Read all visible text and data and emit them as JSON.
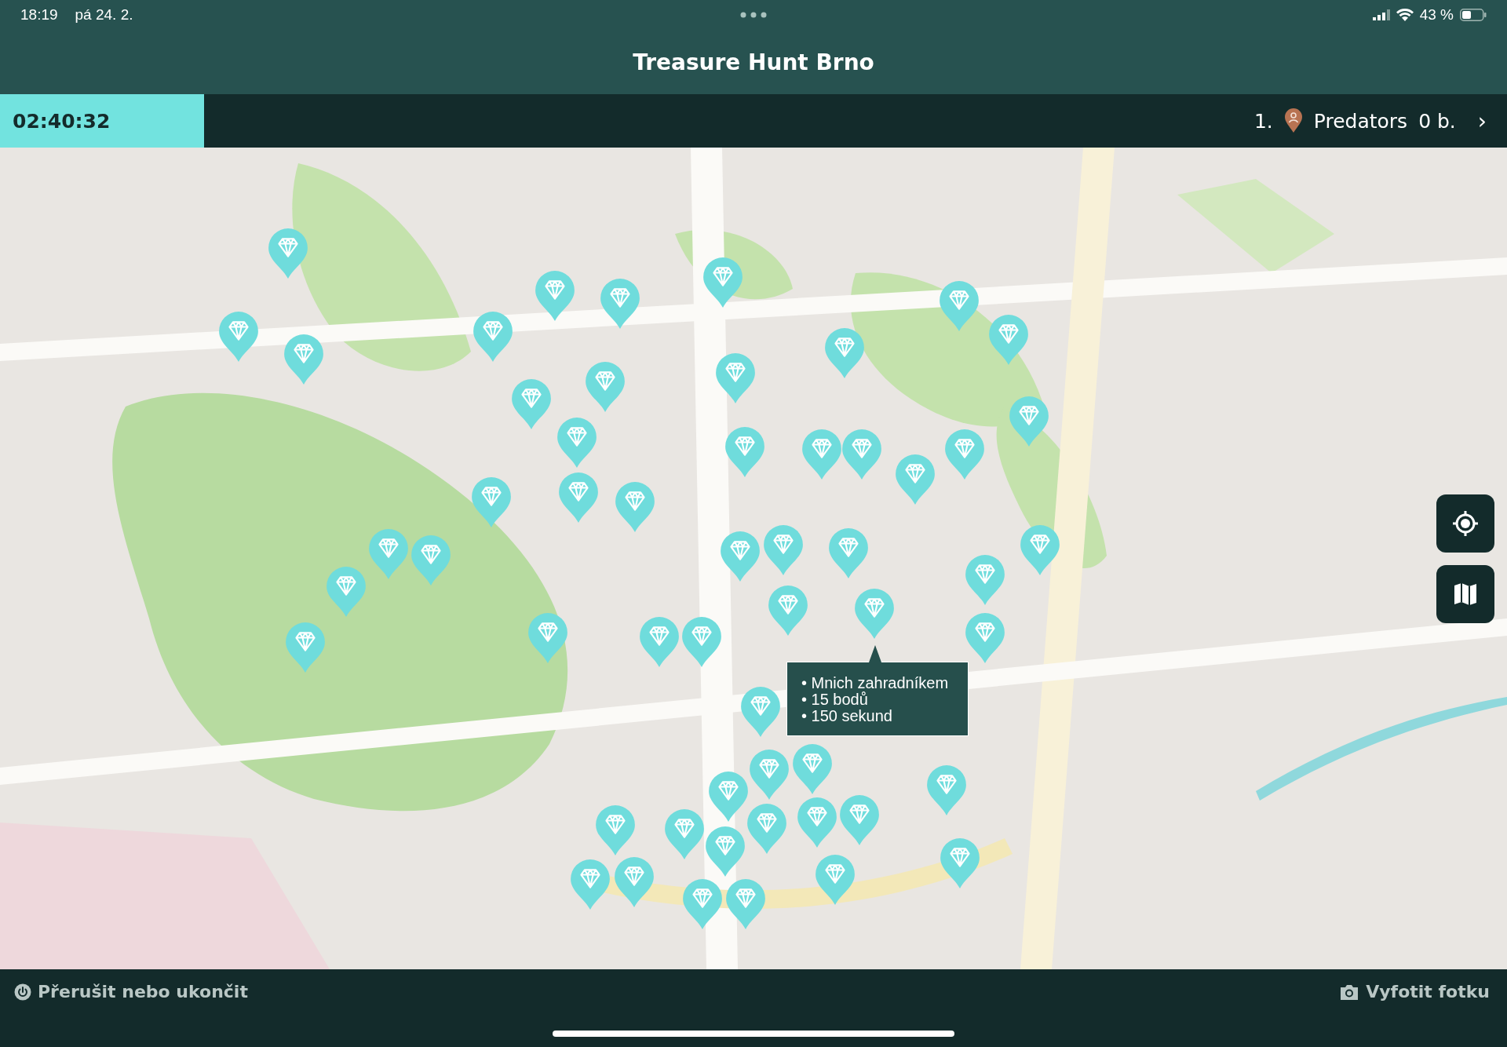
{
  "status_bar": {
    "time": "18:19",
    "date": "pá 24. 2.",
    "battery": "43 %"
  },
  "title": "Treasure Hunt Brno",
  "timer": "02:40:32",
  "team": {
    "rank": "1.",
    "name": "Predators",
    "score": "0 b.",
    "arrow": "›"
  },
  "tooltip": {
    "items": [
      "• Mnich zahradníkem",
      "• 15 bodů",
      "• 150 sekund"
    ]
  },
  "bottom_bar": {
    "left_button": "Přerušit nebo ukončit",
    "right_button": "Vyfotit fotku"
  }
}
